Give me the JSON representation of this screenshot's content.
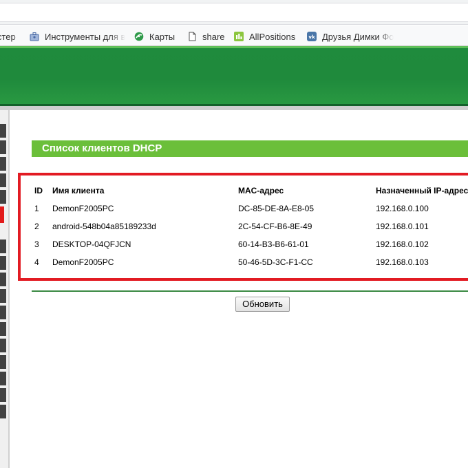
{
  "browser": {
    "bookmarks": [
      {
        "label": "стер",
        "icon": "tool-icon"
      },
      {
        "label": "Инструменты для в",
        "icon": "toolbox-icon"
      },
      {
        "label": "Карты",
        "icon": "maps-icon"
      },
      {
        "label": "share",
        "icon": "page-icon"
      },
      {
        "label": "AllPositions",
        "icon": "allpositions-icon"
      },
      {
        "label": "Друзья Димки Фо",
        "icon": "vk-icon"
      }
    ]
  },
  "page": {
    "title": "Список клиентов DHCP",
    "table": {
      "headers": [
        "ID",
        "Имя клиента",
        "MAC-адрес",
        "Назначенный IP-адрес"
      ],
      "rows": [
        [
          "1",
          "DemonF2005PC",
          "DC-85-DE-8A-E8-05",
          "192.168.0.100"
        ],
        [
          "2",
          "android-548b04a85189233d",
          "2C-54-CF-B6-8E-49",
          "192.168.0.101"
        ],
        [
          "3",
          "DESKTOP-04QFJCN",
          "60-14-B3-B6-61-01",
          "192.168.0.102"
        ],
        [
          "4",
          "DemonF2005PC",
          "50-46-5D-3C-F1-CC",
          "192.168.0.103"
        ]
      ]
    },
    "refresh_label": "Обновить"
  },
  "colors": {
    "header_green": "#1f8a3c",
    "title_green": "#6bbf3a",
    "highlight_red": "#e21b23"
  }
}
